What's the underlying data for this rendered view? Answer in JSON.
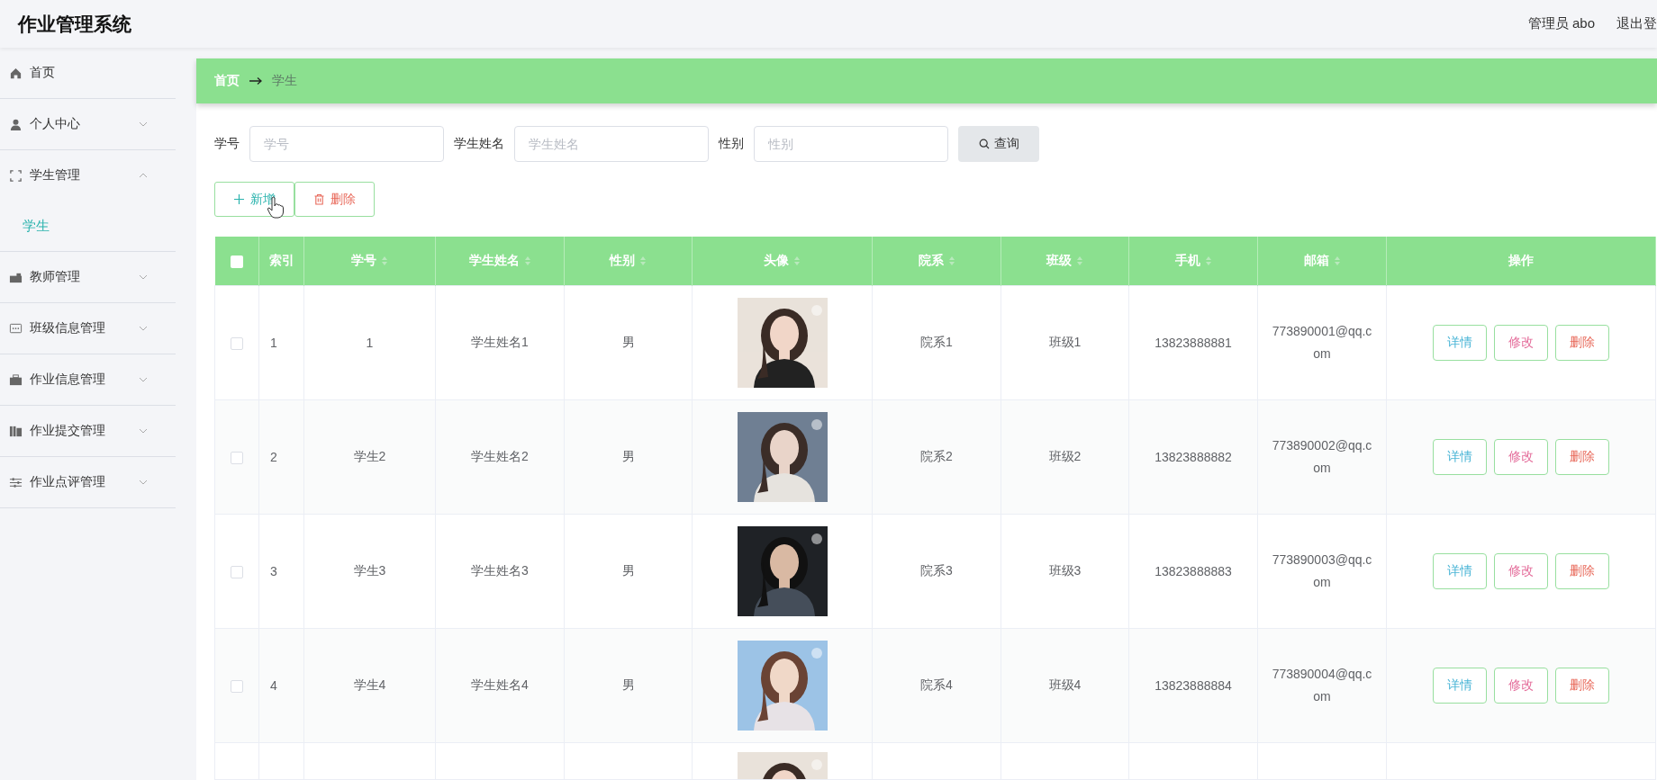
{
  "app_title": "作业管理系统",
  "header": {
    "user": "管理员 abo",
    "logout": "退出登"
  },
  "sidebar": {
    "items": [
      {
        "label": "首页",
        "kind": "link"
      },
      {
        "label": "个人中心",
        "kind": "group",
        "expanded": false
      },
      {
        "label": "学生管理",
        "kind": "group",
        "expanded": true,
        "children": [
          {
            "label": "学生",
            "selected": true
          }
        ]
      },
      {
        "label": "教师管理",
        "kind": "group",
        "expanded": false
      },
      {
        "label": "班级信息管理",
        "kind": "group",
        "expanded": false
      },
      {
        "label": "作业信息管理",
        "kind": "group",
        "expanded": false
      },
      {
        "label": "作业提交管理",
        "kind": "group",
        "expanded": false
      },
      {
        "label": "作业点评管理",
        "kind": "group",
        "expanded": false
      }
    ]
  },
  "breadcrumb": [
    {
      "label": "首页",
      "current": false
    },
    {
      "label": "学生",
      "current": true
    }
  ],
  "search": {
    "fields": [
      {
        "label": "学号",
        "placeholder": "学号"
      },
      {
        "label": "学生姓名",
        "placeholder": "学生姓名"
      },
      {
        "label": "性别",
        "placeholder": "性别"
      }
    ],
    "button": "查询"
  },
  "actions": [
    {
      "label": "新增",
      "kind": "add"
    },
    {
      "label": "删除",
      "kind": "delete"
    }
  ],
  "table": {
    "columns": [
      {
        "kind": "checkbox",
        "checked": false
      },
      {
        "kind": "text",
        "label": "索引",
        "sortable": false
      },
      {
        "kind": "text",
        "label": "学号",
        "sortable": true
      },
      {
        "kind": "text",
        "label": "学生姓名",
        "sortable": true
      },
      {
        "kind": "text",
        "label": "性别",
        "sortable": true
      },
      {
        "kind": "picture",
        "label": "头像",
        "sortable": true
      },
      {
        "kind": "text",
        "label": "院系",
        "sortable": true
      },
      {
        "kind": "text",
        "label": "班级",
        "sortable": true
      },
      {
        "kind": "text",
        "label": "手机",
        "sortable": true
      },
      {
        "kind": "text",
        "label": "邮箱",
        "sortable": true
      },
      {
        "kind": "actions",
        "label": "操作",
        "sortable": false
      }
    ],
    "rows": [
      {
        "cells": [
          {
            "kind": "checkbox",
            "checked": false
          },
          "1",
          "1",
          "学生姓名1",
          "男",
          {
            "kind": "picture"
          },
          "院系1",
          "班级1",
          "13823888881",
          "773890001@qq.com",
          {
            "kind": "actions",
            "buttons": [
              {
                "label": "详情",
                "kind": "detail"
              },
              {
                "label": "修改",
                "kind": "edit"
              },
              {
                "label": "删除",
                "kind": "delete"
              }
            ]
          }
        ]
      },
      {
        "cells": [
          {
            "kind": "checkbox",
            "checked": false
          },
          "2",
          "学生2",
          "学生姓名2",
          "男",
          {
            "kind": "picture"
          },
          "院系2",
          "班级2",
          "13823888882",
          "773890002@qq.com",
          {
            "kind": "actions",
            "buttons": [
              {
                "label": "详情",
                "kind": "detail"
              },
              {
                "label": "修改",
                "kind": "edit"
              },
              {
                "label": "删除",
                "kind": "delete"
              }
            ]
          }
        ]
      },
      {
        "cells": [
          {
            "kind": "checkbox",
            "checked": false
          },
          "3",
          "学生3",
          "学生姓名3",
          "男",
          {
            "kind": "picture"
          },
          "院系3",
          "班级3",
          "13823888883",
          "773890003@qq.com",
          {
            "kind": "actions",
            "buttons": [
              {
                "label": "详情",
                "kind": "detail"
              },
              {
                "label": "修改",
                "kind": "edit"
              },
              {
                "label": "删除",
                "kind": "delete"
              }
            ]
          }
        ]
      },
      {
        "cells": [
          {
            "kind": "checkbox",
            "checked": false
          },
          "4",
          "学生4",
          "学生姓名4",
          "男",
          {
            "kind": "picture"
          },
          "院系4",
          "班级4",
          "13823888884",
          "773890004@qq.com",
          {
            "kind": "actions",
            "buttons": [
              {
                "label": "详情",
                "kind": "detail"
              },
              {
                "label": "修改",
                "kind": "edit"
              },
              {
                "label": "删除",
                "kind": "delete"
              }
            ]
          }
        ]
      }
    ]
  }
}
